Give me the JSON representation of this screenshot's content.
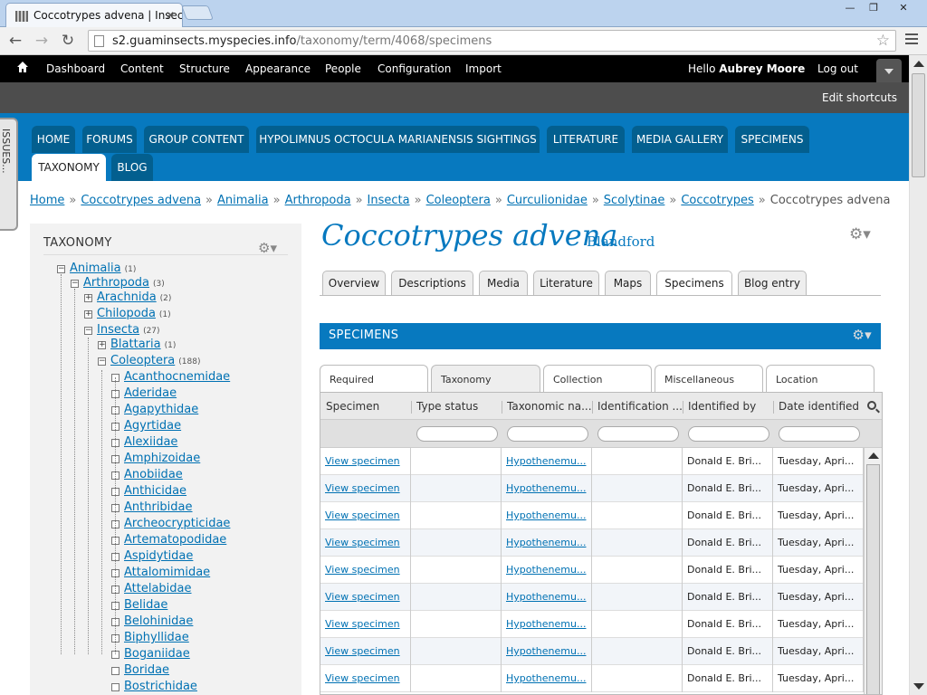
{
  "browser": {
    "tab_title": "Coccotrypes advena | Insect",
    "tab_close": "✕",
    "url_host": "s2.guaminsects.myspecies.info",
    "url_path": "/taxonomy/term/4068/specimens",
    "win_minimize": "—",
    "win_maximize": "❐",
    "win_close": "✕",
    "back": "←",
    "forward": "→",
    "reload": "↻",
    "star": "☆"
  },
  "admin": {
    "menu": [
      "Dashboard",
      "Content",
      "Structure",
      "Appearance",
      "People",
      "Configuration",
      "Import"
    ],
    "hello_prefix": "Hello",
    "user": "Aubrey Moore",
    "logout": "Log out",
    "edit_shortcuts": "Edit shortcuts"
  },
  "issues_tab": "ISSUES...",
  "nav_tabs": [
    "HOME",
    "FORUMS",
    "GROUP CONTENT",
    "HYPOLIMNUS OCTOCULA MARIANENSIS SIGHTINGS",
    "LITERATURE",
    "MEDIA GALLERY",
    "SPECIMENS",
    "TAXONOMY",
    "BLOG"
  ],
  "breadcrumb": {
    "links": [
      "Home",
      "Coccotrypes advena",
      "Animalia",
      "Arthropoda",
      "Insecta",
      "Coleoptera",
      "Curculionidae",
      "Scolytinae",
      "Coccotrypes"
    ],
    "current": "Coccotrypes advena",
    "separator": "»"
  },
  "sidebar": {
    "title": "TAXONOMY",
    "gear": "⚙▾",
    "tree": [
      {
        "label": "Animalia",
        "count": "(1)",
        "toggle": "−"
      },
      {
        "label": "Arthropoda",
        "count": "(3)",
        "toggle": "−"
      },
      {
        "label": "Arachnida",
        "count": "(2)",
        "toggle": "+"
      },
      {
        "label": "Chilopoda",
        "count": "(1)",
        "toggle": "+"
      },
      {
        "label": "Insecta",
        "count": "(27)",
        "toggle": "−"
      },
      {
        "label": "Blattaria",
        "count": "(1)",
        "toggle": "+"
      },
      {
        "label": "Coleoptera",
        "count": "(188)",
        "toggle": "−"
      },
      {
        "label": "Acanthocnemidae",
        "count": "",
        "toggle": ""
      },
      {
        "label": "Aderidae",
        "count": "",
        "toggle": ""
      },
      {
        "label": "Agapythidae",
        "count": "",
        "toggle": ""
      },
      {
        "label": "Agyrtidae",
        "count": "",
        "toggle": ""
      },
      {
        "label": "Alexiidae",
        "count": "",
        "toggle": ""
      },
      {
        "label": "Amphizoidae",
        "count": "",
        "toggle": ""
      },
      {
        "label": "Anobiidae",
        "count": "",
        "toggle": ""
      },
      {
        "label": "Anthicidae",
        "count": "",
        "toggle": ""
      },
      {
        "label": "Anthribidae",
        "count": "",
        "toggle": ""
      },
      {
        "label": "Archeocrypticidae",
        "count": "",
        "toggle": ""
      },
      {
        "label": "Artematopodidae",
        "count": "",
        "toggle": ""
      },
      {
        "label": "Aspidytidae",
        "count": "",
        "toggle": ""
      },
      {
        "label": "Attalomimidae",
        "count": "",
        "toggle": ""
      },
      {
        "label": "Attelabidae",
        "count": "",
        "toggle": ""
      },
      {
        "label": "Belidae",
        "count": "",
        "toggle": ""
      },
      {
        "label": "Belohinidae",
        "count": "",
        "toggle": ""
      },
      {
        "label": "Biphyllidae",
        "count": "",
        "toggle": ""
      },
      {
        "label": "Boganiidae",
        "count": "",
        "toggle": ""
      },
      {
        "label": "Boridae",
        "count": "",
        "toggle": ""
      },
      {
        "label": "Bostrichidae",
        "count": "",
        "toggle": ""
      }
    ]
  },
  "page": {
    "title": "Coccotrypes advena",
    "author": "Blandford",
    "gear": "⚙▾"
  },
  "content_tabs": [
    "Overview",
    "Descriptions",
    "Media",
    "Literature",
    "Maps",
    "Specimens",
    "Blog entry"
  ],
  "specimens": {
    "title": "SPECIMENS",
    "gear": "⚙▾",
    "field_tabs": [
      "Required",
      "Taxonomy",
      "Collection",
      "Miscellaneous",
      "Location"
    ],
    "columns": [
      "Specimen",
      "Type status",
      "Taxonomic na...",
      "Identification ...",
      "Identified by",
      "Date identified"
    ],
    "rows": [
      [
        "View specimen",
        "",
        "Hypothenemu...",
        "",
        "Donald E. Bri...",
        "Tuesday, Apri..."
      ],
      [
        "View specimen",
        "",
        "Hypothenemu...",
        "",
        "Donald E. Bri...",
        "Tuesday, Apri..."
      ],
      [
        "View specimen",
        "",
        "Hypothenemu...",
        "",
        "Donald E. Bri...",
        "Tuesday, Apri..."
      ],
      [
        "View specimen",
        "",
        "Hypothenemu...",
        "",
        "Donald E. Bri...",
        "Tuesday, Apri..."
      ],
      [
        "View specimen",
        "",
        "Hypothenemu...",
        "",
        "Donald E. Bri...",
        "Tuesday, Apri..."
      ],
      [
        "View specimen",
        "",
        "Hypothenemu...",
        "",
        "Donald E. Bri...",
        "Tuesday, Apri..."
      ],
      [
        "View specimen",
        "",
        "Hypothenemu...",
        "",
        "Donald E. Bri...",
        "Tuesday, Apri..."
      ],
      [
        "View specimen",
        "",
        "Hypothenemu...",
        "",
        "Donald E. Bri...",
        "Tuesday, Apri..."
      ],
      [
        "View specimen",
        "",
        "Hypothenemu...",
        "",
        "Donald E. Bri...",
        "Tuesday, Apri..."
      ]
    ]
  },
  "colors": {
    "brand_blue": "#0779bf",
    "nav_tab": "#035f8f",
    "link": "#0071b3"
  }
}
